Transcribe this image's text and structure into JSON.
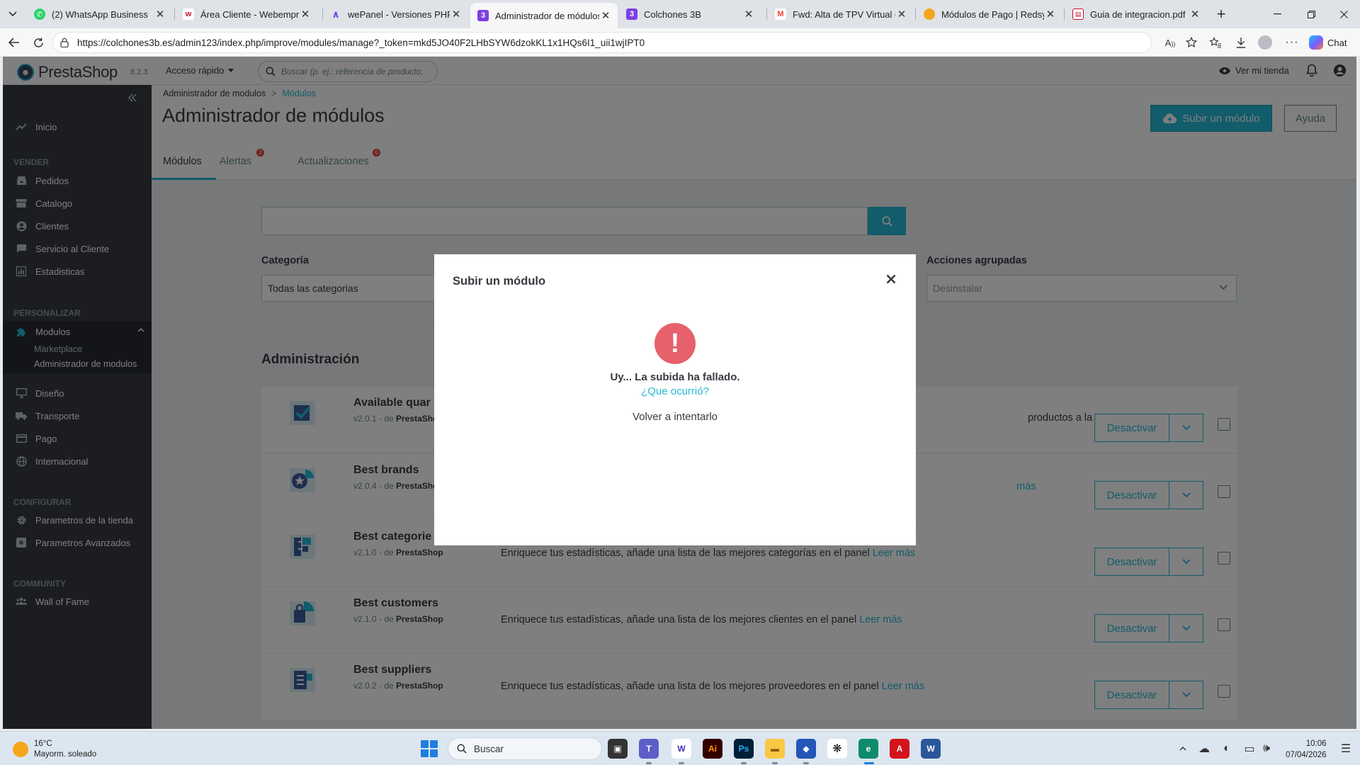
{
  "browser": {
    "tabs": [
      {
        "title": "(2) WhatsApp Business",
        "icon": "whatsapp-icon",
        "color": "#25d366"
      },
      {
        "title": "Área Cliente - Webempresa",
        "icon": "webempresa-icon",
        "color": "#c8102e"
      },
      {
        "title": "wePanel - Versiones PHP",
        "icon": "wepanel-icon",
        "color": "#7b3fe4"
      },
      {
        "title": "Administrador de módulos",
        "icon": "prestashop-tab-icon",
        "color": "#7b3fe4",
        "active": true
      },
      {
        "title": "Colchones 3B",
        "icon": "colchones-icon",
        "color": "#7b3fe4"
      },
      {
        "title": "Fwd: Alta de TPV Virtual en p",
        "icon": "gmail-icon",
        "color": "#ea4335"
      },
      {
        "title": "Módulos de Pago | Redsys | P",
        "icon": "redsys-icon",
        "color": "#f4a51c"
      },
      {
        "title": "Guia de integracion.pdf",
        "icon": "pdf-icon",
        "color": "#c8102e"
      }
    ],
    "url": "https://colchones3b.es/admin123/index.php/improve/modules/manage?_token=mkd5JO40F2LHbSYW6dzokKL1x1HQs6I1_uii1wjIPT0",
    "chat_label": "Chat"
  },
  "header": {
    "logo_text": "PrestaShop",
    "version": "8.2.3",
    "quick_access": "Acceso rápido",
    "search_placeholder": "Buscar (p. ej.: referencia de producto,",
    "view_store": "Ver mi tienda"
  },
  "sidebar": {
    "home": "Inicio",
    "sections": {
      "sell": "VENDER",
      "customize": "PERSONALIZAR",
      "configure": "CONFIGURAR",
      "community": "COMMUNITY"
    },
    "sell_items": [
      "Pedidos",
      "Catalogo",
      "Clientes",
      "Servicio al Cliente",
      "Estadisticas"
    ],
    "modules": "Modulos",
    "modules_sub": [
      "Marketplace",
      "Administrador de modulos"
    ],
    "customize_items": [
      "Diseño",
      "Transporte",
      "Pago",
      "Internacional"
    ],
    "configure_items": [
      "Parametros de la tienda",
      "Parametros Avanzados"
    ],
    "community_items": [
      "Wall of Fame"
    ]
  },
  "page": {
    "breadcrumb_parent": "Administrador de modulos",
    "breadcrumb_separator": ">",
    "breadcrumb_current": "Módulos",
    "title": "Administrador de módulos",
    "upload_button": "Subir un módulo",
    "help_button": "Ayuda",
    "tabs": [
      {
        "label": "Módulos",
        "badge": ""
      },
      {
        "label": "Alertas",
        "badge": "2"
      },
      {
        "label": "Actualizaciones",
        "badge": "0"
      }
    ]
  },
  "filters": {
    "category_label": "Categoría",
    "category_value": "Todas las categorias",
    "bulk_label": "Acciones agrupadas",
    "bulk_value": "Desinstalar"
  },
  "section_title": "Administración",
  "modules": [
    {
      "name": "Available quar",
      "version": "v2.0.1 - de ",
      "author": "PrestaShop",
      "desc": "productos a la",
      "more": "",
      "action": "Desactivar"
    },
    {
      "name": "Best brands",
      "version": "v2.0.4 - de ",
      "author": "PrestaShop",
      "desc": "",
      "more": "más",
      "action": "Desactivar"
    },
    {
      "name": "Best categorie",
      "version": "v2.1.0 - de ",
      "author": "PrestaShop",
      "desc": "Enriquece tus estadísticas, añade una lista de las mejores categorías en el panel ",
      "more": "Leer más",
      "action": "Desactivar"
    },
    {
      "name": "Best customers",
      "version": "v2.1.0 - de ",
      "author": "PrestaShop",
      "desc": "Enriquece tus estadísticas, añade una lista de los mejores clientes en el panel ",
      "more": "Leer más",
      "action": "Desactivar"
    },
    {
      "name": "Best suppliers",
      "version": "v2.0.2 - de ",
      "author": "PrestaShop",
      "desc": "Enriquece tus estadísticas, añade una lista de los mejores proveedores en el panel ",
      "more": "Leer más",
      "action": "Desactivar"
    }
  ],
  "modal": {
    "title": "Subir un módulo",
    "error_message": "Uy... La subida ha fallado.",
    "error_link": "¿Que ocurrió?",
    "retry": "Volver a intentarlo"
  },
  "taskbar": {
    "temperature": "16°C",
    "weather": "Mayorm. soleado",
    "search": "Buscar",
    "time": "10:06",
    "date": "07/04/2026"
  },
  "colors": {
    "accent": "#25b9d7",
    "sidebar": "#363a41",
    "error": "#e6616b",
    "badge": "#e4433b"
  }
}
